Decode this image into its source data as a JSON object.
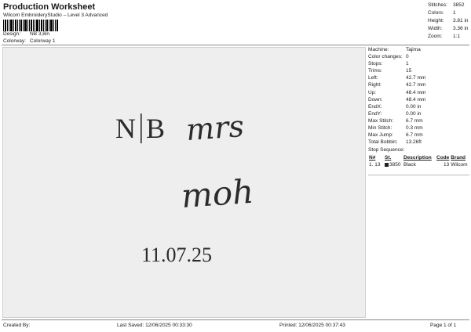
{
  "header": {
    "title": "Production Worksheet",
    "subtitle": "Wilcom EmbroideryStudio – Level 3 Advanced",
    "design_label": "Design:",
    "design_value": "NB 3,8in",
    "colorway_label": "Colorway:",
    "colorway_value": "Colorway 1"
  },
  "stats": [
    {
      "label": "Stitches:",
      "value": "3852"
    },
    {
      "label": "Colors:",
      "value": "1"
    },
    {
      "label": "Height:",
      "value": "3.81 in"
    },
    {
      "label": "Width:",
      "value": "3.36 in"
    },
    {
      "label": "Zoom:",
      "value": "1:1"
    }
  ],
  "design_text": {
    "initials_left": "N",
    "initials_right": "B",
    "script_1": "mrs",
    "script_2": "moh",
    "date": "11.07.25"
  },
  "machine_details": [
    {
      "label": "Machine:",
      "value": "Tajima"
    },
    {
      "label": "Color changes:",
      "value": "0"
    },
    {
      "label": "Stops:",
      "value": "1"
    },
    {
      "label": "Trims:",
      "value": "15"
    },
    {
      "label": "Left:",
      "value": "42.7 mm"
    },
    {
      "label": "Right:",
      "value": "42.7 mm"
    },
    {
      "label": "Up:",
      "value": "48.4 mm"
    },
    {
      "label": "Down:",
      "value": "48.4 mm"
    },
    {
      "label": "EndX:",
      "value": "0.00 in"
    },
    {
      "label": "EndY:",
      "value": "0.00 in"
    },
    {
      "label": "Max Stitch:",
      "value": "6.7 mm"
    },
    {
      "label": "Min Stitch:",
      "value": "0.3 mm"
    },
    {
      "label": "Max Jump:",
      "value": "6.7 mm"
    },
    {
      "label": "Total Bobbin:",
      "value": "13.26ft"
    }
  ],
  "stop_sequence": {
    "title": "Stop Sequence:",
    "columns": [
      "N#",
      "St.",
      "Description",
      "Code",
      "Brand"
    ],
    "rows": [
      {
        "index": "1.",
        "n": "13",
        "stitches": "3850",
        "description": "Black",
        "code": "13",
        "brand": "Wilcom",
        "color": "#222222"
      }
    ]
  },
  "footer": {
    "created": "Created By:",
    "saved": "Last Saved: 12/06/2025 00:33:30",
    "printed": "Printed: 12/06/2025 00:37:43",
    "page": "Page 1 of 1"
  },
  "colors": {
    "thread": "#2b2b2b",
    "canvas": "#eeeeee"
  }
}
